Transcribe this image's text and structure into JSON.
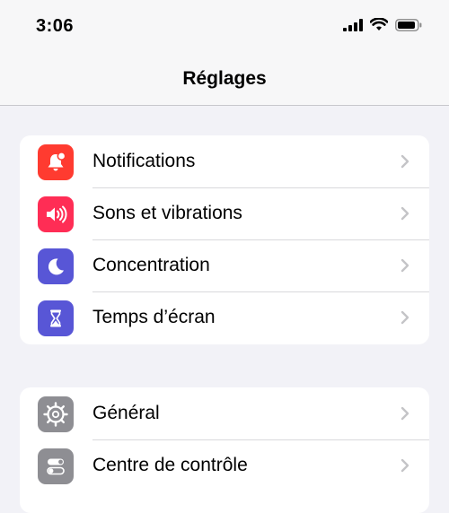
{
  "status_bar": {
    "time": "3:06"
  },
  "nav": {
    "title": "Réglages"
  },
  "groups": [
    {
      "items": [
        {
          "label": "Notifications",
          "icon": "bell-badge-icon",
          "color": "#ff3b30"
        },
        {
          "label": "Sons et vibrations",
          "icon": "speaker-icon",
          "color": "#ff2d55"
        },
        {
          "label": "Concentration",
          "icon": "moon-icon",
          "color": "#5856d6"
        },
        {
          "label": "Temps d’écran",
          "icon": "hourglass-icon",
          "color": "#5856d6"
        }
      ]
    },
    {
      "items": [
        {
          "label": "Général",
          "icon": "gear-icon",
          "color": "#8e8e93"
        },
        {
          "label": "Centre de contrôle",
          "icon": "toggles-icon",
          "color": "#8e8e93"
        }
      ]
    }
  ],
  "colors": {
    "background": "#f2f2f7",
    "chevron": "#c4c4c7",
    "separator": "#d8d8dc"
  }
}
